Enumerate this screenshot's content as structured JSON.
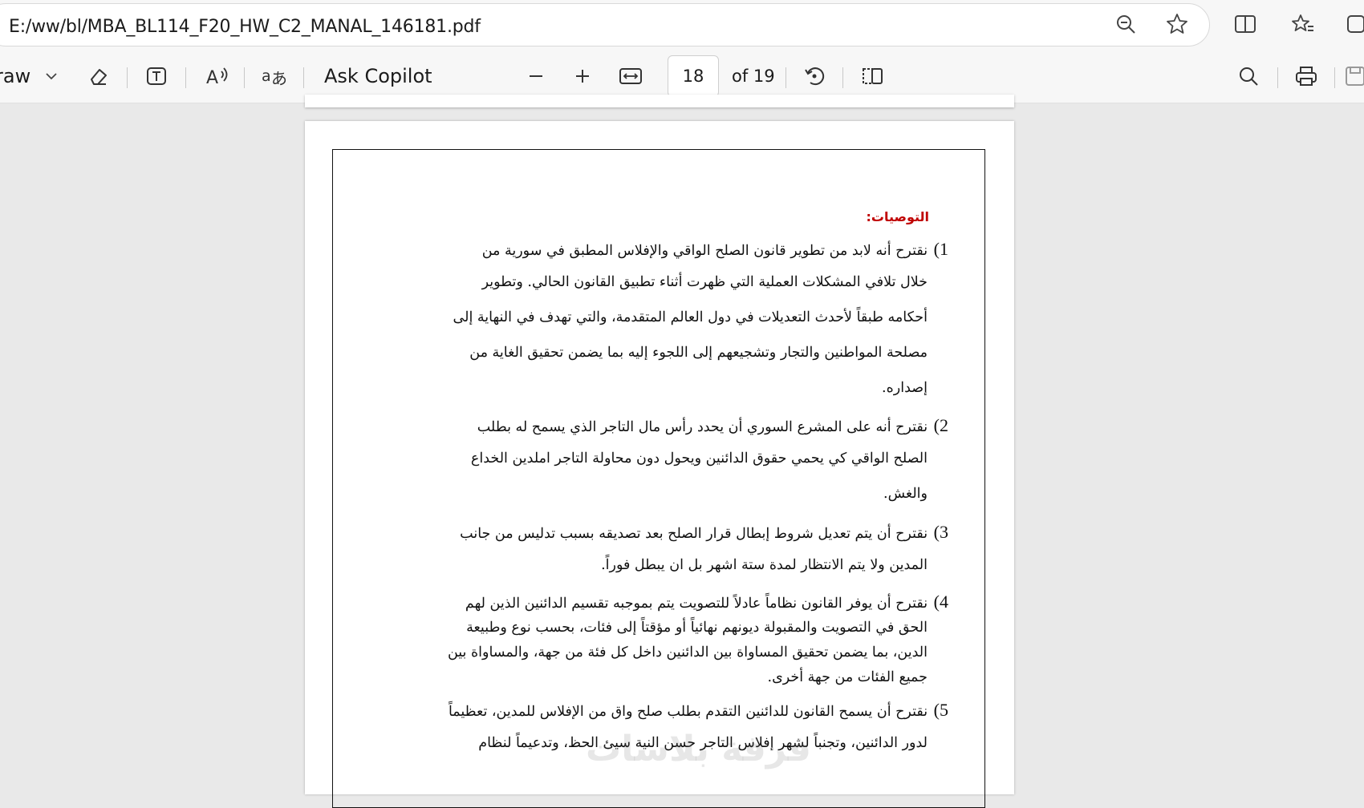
{
  "browser": {
    "address": "E:/ww/bl/MBA_BL114_F20_HW_C2_MANAL_146181.pdf"
  },
  "toolbar": {
    "draw_label": "raw",
    "ask_copilot": "Ask Copilot",
    "page_number": "18",
    "page_total": "of 19"
  },
  "document": {
    "heading": "التوصيات:",
    "recommendations": [
      {
        "number": "1)",
        "lines": [
          "نقترح أنه لابد من تطوير قانون الصلح الواقي والإفلاس المطبق في سورية من",
          "خلال تلافي المشكلات العملية التي ظهرت أثناء تطبيق القانون الحالي. وتطوير",
          "أحكامه طبقاً لأحدث التعديلات في دول العالم المتقدمة، والتي تهدف في النهاية إلى",
          "مصلحة المواطنين والتجار وتشجيعهم إلى اللجوء إليه بما يضمن تحقيق الغاية من",
          "إصداره."
        ]
      },
      {
        "number": "2)",
        "lines": [
          "نقترح أنه على المشرع السوري أن يحدد رأس مال التاجر الذي يسمح له بطلب",
          "الصلح الواقي كي يحمي حقوق الدائنين ويحول دون محاولة التاجر املدين الخداع",
          "والغش."
        ]
      },
      {
        "number": "3)",
        "lines": [
          "نقترح أن يتم تعديل شروط إبطال قرار الصلح بعد تصديقه بسبب تدليس من جانب",
          "المدين ولا يتم الانتظار لمدة ستة اشهر بل ان يبطل فوراً."
        ]
      },
      {
        "number": "4)",
        "lines": [
          "نقترح أن يوفر القانون نظاماً عادلاً للتصويت يتم بموجبه تقسيم الدائنين الذين لهم",
          "الحق في التصويت والمقبولة ديونهم نهائياً أو مؤقتاً إلى فئات، بحسب نوع وطبيعة",
          "الدين، بما يضمن تحقيق المساواة بين الدائنين داخل كل فئة من جهة، والمساواة بين",
          "جميع الفئات من جهة أخرى."
        ]
      },
      {
        "number": "5)",
        "lines": [
          "نقترح أن يسمح القانون للدائنين التقدم بطلب صلح واق من الإفلاس للمدين، تعظيماً",
          "لدور الدائنين، وتجنباً لشهر إفلاس التاجر حسن النية سيئ الحظ، وتدعيماً لنظام"
        ]
      }
    ],
    "watermark": "فرقة بلاسات"
  },
  "colors": {
    "heading": "#c00000",
    "toolbar_bg": "#f7f7f7",
    "viewport_bg": "#e9e9e9"
  }
}
